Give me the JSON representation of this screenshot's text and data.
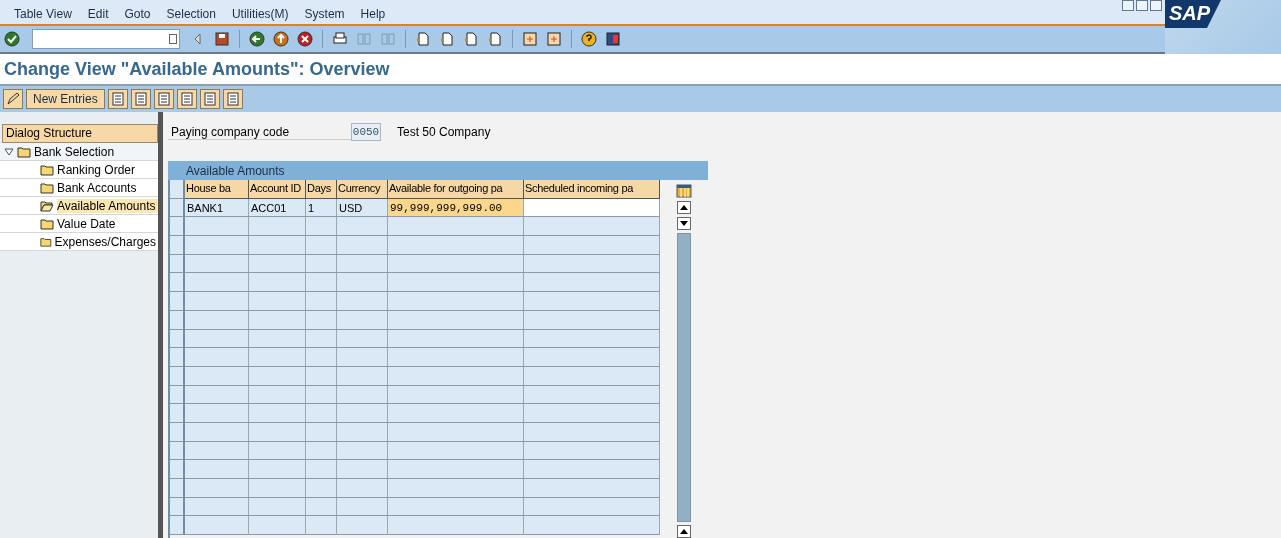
{
  "menu": [
    "Table View",
    "Edit",
    "Goto",
    "Selection",
    "Utilities(M)",
    "System",
    "Help"
  ],
  "logo": "SAP",
  "title": "Change View \"Available Amounts\": Overview",
  "app_toolbar": {
    "new_entries": "New Entries"
  },
  "dialog_structure": {
    "title": "Dialog Structure",
    "items": [
      {
        "label": "Bank Selection",
        "expanded": true,
        "selected": false,
        "children": [
          {
            "label": "Ranking Order",
            "selected": false
          },
          {
            "label": "Bank Accounts",
            "selected": false
          },
          {
            "label": "Available Amounts",
            "selected": true
          },
          {
            "label": "Value Date",
            "selected": false
          },
          {
            "label": "Expenses/Charges",
            "selected": false
          }
        ]
      }
    ]
  },
  "header_field": {
    "label": "Paying company code",
    "value": "0050",
    "description": "Test 50 Company"
  },
  "table": {
    "title": "Available Amounts",
    "columns": [
      "House ba",
      "Account ID",
      "Days",
      "Currency",
      "Available for outgoing pa",
      "Scheduled incoming pa"
    ],
    "rows": [
      {
        "cells": [
          {
            "text": "BANK1",
            "editable": false,
            "focused": false
          },
          {
            "text": "ACC01",
            "editable": false,
            "focused": false
          },
          {
            "text": "1",
            "editable": false,
            "focused": false
          },
          {
            "text": "USD",
            "editable": false,
            "focused": false
          },
          {
            "text": "99,999,999,999.00",
            "editable": true,
            "focused": true
          },
          {
            "editable": true,
            "focused": false
          }
        ]
      }
    ]
  }
}
